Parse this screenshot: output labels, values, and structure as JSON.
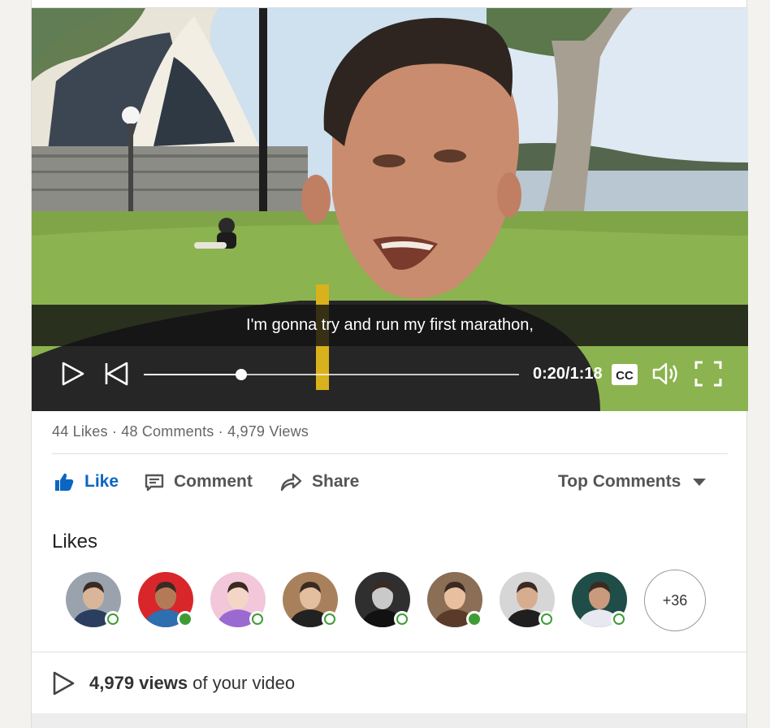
{
  "video": {
    "caption": "I'm gonna try and run my first marathon,",
    "time_display": "0:20/1:18",
    "progress_fraction": 0.26,
    "cc_label": "CC"
  },
  "stats": {
    "text": "44 Likes · 48 Comments · 4,979 Views"
  },
  "actions": {
    "like_label": "Like",
    "comment_label": "Comment",
    "share_label": "Share",
    "sort_label": "Top Comments"
  },
  "likes": {
    "title": "Likes",
    "avatars": [
      {
        "status": "ring",
        "bg": "#9aa3ad",
        "skin": "#d9b59a",
        "shirt": "#2b3e5f"
      },
      {
        "status": "dot",
        "bg": "#d8262b",
        "skin": "#b47a57",
        "shirt": "#2e6fb0"
      },
      {
        "status": "ring",
        "bg": "#f1c7d9",
        "skin": "#f3d6c6",
        "shirt": "#9b6ad1"
      },
      {
        "status": "ring",
        "bg": "#a8815c",
        "skin": "#e3bfa0",
        "shirt": "#222222"
      },
      {
        "status": "ring",
        "bg": "#2f2f2f",
        "skin": "#c9c9c9",
        "shirt": "#111111"
      },
      {
        "status": "dot",
        "bg": "#8a6e55",
        "skin": "#e8c0a0",
        "shirt": "#5a3b2a"
      },
      {
        "status": "ring",
        "bg": "#d6d6d6",
        "skin": "#d7ad8f",
        "shirt": "#1f1f1f"
      },
      {
        "status": "ring",
        "bg": "#1f4d47",
        "skin": "#c99a7c",
        "shirt": "#e8e8f0"
      }
    ],
    "more_label": "+36"
  },
  "footer": {
    "views_count": "4,979 views",
    "views_suffix": "of your video"
  },
  "colors": {
    "accent": "#0a66c2",
    "online": "#3f9c35"
  }
}
